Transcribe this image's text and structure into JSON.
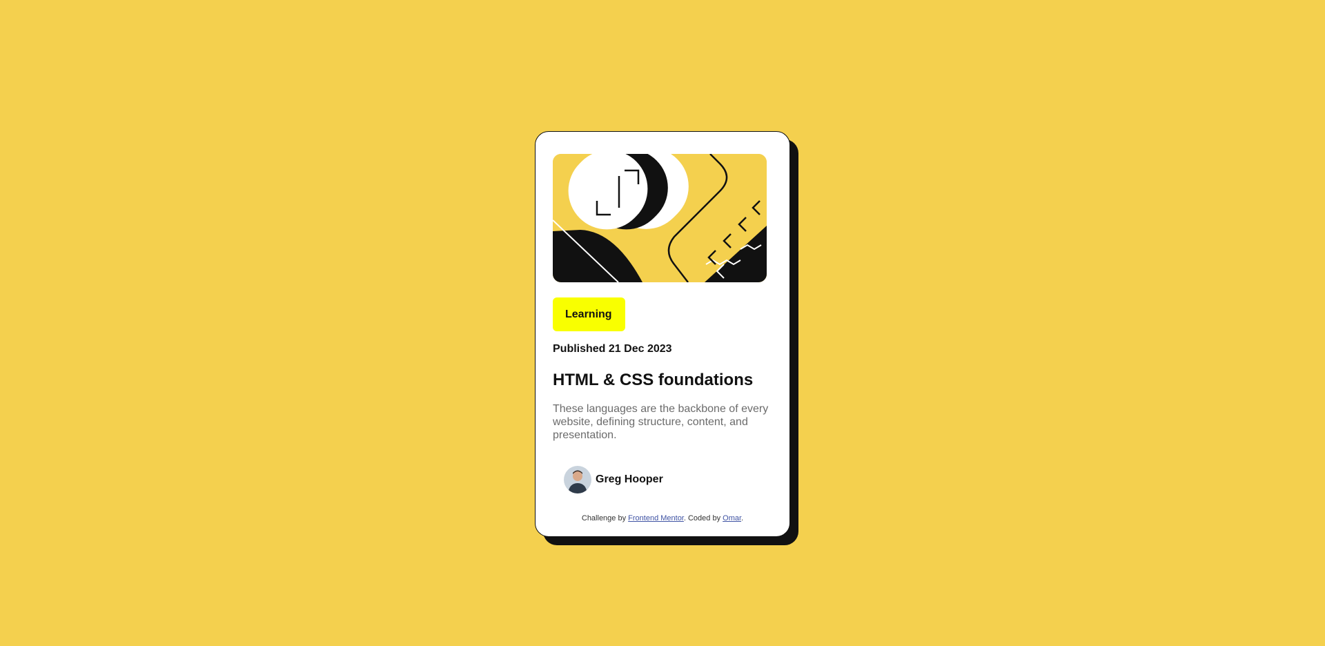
{
  "card": {
    "tag": "Learning",
    "published": "Published 21 Dec 2023",
    "title": "HTML & CSS foundations",
    "description": "These languages are the backbone of every website, defining structure, content, and presentation.",
    "author": {
      "name": "Greg Hooper"
    }
  },
  "attribution": {
    "prefix": "Challenge by ",
    "link1": "Frontend Mentor",
    "middle": ". Coded by ",
    "link2": "Omar",
    "suffix": "."
  },
  "colors": {
    "background": "#F4D04E",
    "card": "#FFFFFF",
    "tag": "#F9FF00",
    "ink": "#111111",
    "muted": "#6B6B6B",
    "link": "#3E52A3"
  },
  "icons": {
    "hero": "abstract-illustration",
    "avatar": "person-portrait"
  }
}
